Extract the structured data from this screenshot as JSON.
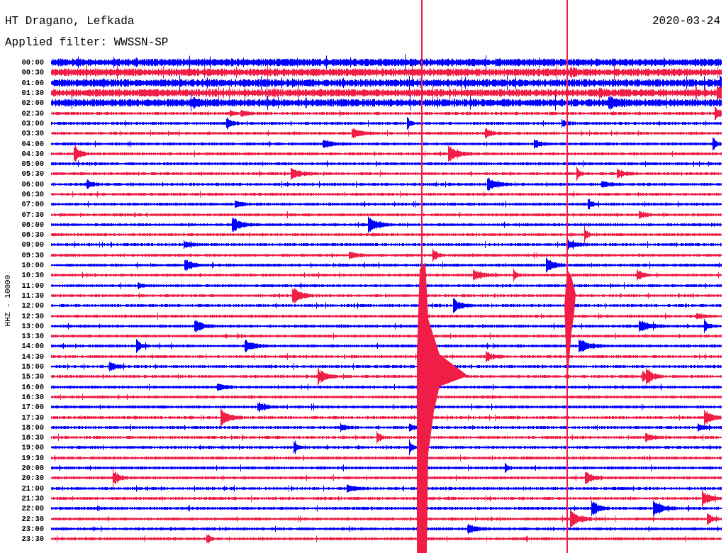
{
  "title": "HT Dragano, Lefkada",
  "date": "2020-03-24",
  "filter": "Applied filter: WWSSN-SP",
  "axis_label": "HHZ - 10000",
  "rows": [
    {
      "time": "00:00",
      "color": "#0000ff"
    },
    {
      "time": "00:30",
      "color": "#f01e46"
    },
    {
      "time": "01:00",
      "color": "#0000ff"
    },
    {
      "time": "01:30",
      "color": "#f01e46"
    },
    {
      "time": "02:00",
      "color": "#0000ff"
    },
    {
      "time": "02:30",
      "color": "#f01e46"
    },
    {
      "time": "03:00",
      "color": "#0000ff"
    },
    {
      "time": "03:30",
      "color": "#f01e46"
    },
    {
      "time": "04:00",
      "color": "#0000ff"
    },
    {
      "time": "04:30",
      "color": "#f01e46"
    },
    {
      "time": "05:00",
      "color": "#0000ff"
    },
    {
      "time": "05:30",
      "color": "#f01e46"
    },
    {
      "time": "06:00",
      "color": "#0000ff"
    },
    {
      "time": "06:30",
      "color": "#f01e46"
    },
    {
      "time": "07:00",
      "color": "#0000ff"
    },
    {
      "time": "07:30",
      "color": "#f01e46"
    },
    {
      "time": "08:00",
      "color": "#0000ff"
    },
    {
      "time": "08:30",
      "color": "#f01e46"
    },
    {
      "time": "09:00",
      "color": "#0000ff"
    },
    {
      "time": "09:30",
      "color": "#f01e46"
    },
    {
      "time": "10:00",
      "color": "#0000ff"
    },
    {
      "time": "10:30",
      "color": "#f01e46"
    },
    {
      "time": "11:00",
      "color": "#0000ff"
    },
    {
      "time": "11:30",
      "color": "#f01e46"
    },
    {
      "time": "12:00",
      "color": "#0000ff"
    },
    {
      "time": "12:30",
      "color": "#f01e46"
    },
    {
      "time": "13:00",
      "color": "#0000ff"
    },
    {
      "time": "13:30",
      "color": "#f01e46"
    },
    {
      "time": "14:00",
      "color": "#0000ff"
    },
    {
      "time": "14:30",
      "color": "#f01e46"
    },
    {
      "time": "15:00",
      "color": "#0000ff"
    },
    {
      "time": "15:30",
      "color": "#f01e46"
    },
    {
      "time": "16:00",
      "color": "#0000ff"
    },
    {
      "time": "16:30",
      "color": "#f01e46"
    },
    {
      "time": "17:00",
      "color": "#0000ff"
    },
    {
      "time": "17:30",
      "color": "#f01e46"
    },
    {
      "time": "18:00",
      "color": "#0000ff"
    },
    {
      "time": "18:30",
      "color": "#f01e46"
    },
    {
      "time": "19:00",
      "color": "#0000ff"
    },
    {
      "time": "19:30",
      "color": "#f01e46"
    },
    {
      "time": "20:00",
      "color": "#0000ff"
    },
    {
      "time": "20:30",
      "color": "#f01e46"
    },
    {
      "time": "21:00",
      "color": "#0000ff"
    },
    {
      "time": "21:30",
      "color": "#f01e46"
    },
    {
      "time": "22:00",
      "color": "#0000ff"
    },
    {
      "time": "22:30",
      "color": "#f01e46"
    },
    {
      "time": "23:00",
      "color": "#0000ff"
    },
    {
      "time": "23:30",
      "color": "#f01e46"
    }
  ]
}
